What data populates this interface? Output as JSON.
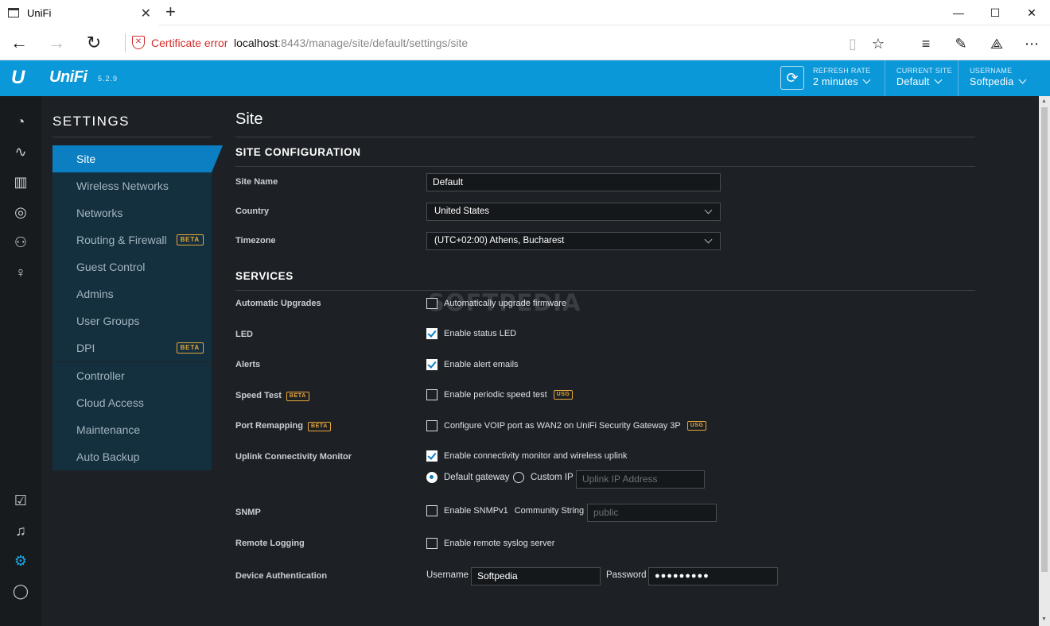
{
  "browser": {
    "tab_title": "UniFi",
    "new_tab_label": "+",
    "cert_error": "Certificate error",
    "url_host": "localhost",
    "url_path": ":8443/manage/site/default/settings/site"
  },
  "header": {
    "app_name": "UniFi",
    "version": "5.2.9",
    "refresh_rate_label": "REFRESH RATE",
    "refresh_rate_value": "2 minutes",
    "current_site_label": "CURRENT SITE",
    "current_site_value": "Default",
    "username_label": "USERNAME",
    "username_value": "Softpedia",
    "accent_color": "#0b98d9"
  },
  "settings_nav": {
    "title": "SETTINGS",
    "group1": [
      {
        "label": "Site",
        "active": true
      },
      {
        "label": "Wireless Networks"
      },
      {
        "label": "Networks"
      },
      {
        "label": "Routing & Firewall",
        "badge": "BETA"
      },
      {
        "label": "Guest Control"
      },
      {
        "label": "Admins"
      },
      {
        "label": "User Groups"
      },
      {
        "label": "DPI",
        "badge": "BETA"
      }
    ],
    "group2": [
      {
        "label": "Controller"
      },
      {
        "label": "Cloud Access"
      },
      {
        "label": "Maintenance"
      },
      {
        "label": "Auto Backup"
      }
    ]
  },
  "content": {
    "page_title": "Site",
    "site_config_title": "SITE CONFIGURATION",
    "site_name_label": "Site Name",
    "site_name_value": "Default",
    "country_label": "Country",
    "country_value": "United States",
    "timezone_label": "Timezone",
    "timezone_value": "(UTC+02:00) Athens, Bucharest",
    "services_title": "SERVICES",
    "auto_upgrades_label": "Automatic Upgrades",
    "auto_upgrades_text": "Automatically upgrade firmware",
    "led_label": "LED",
    "led_text": "Enable status LED",
    "alerts_label": "Alerts",
    "alerts_text": "Enable alert emails",
    "speed_test_label": "Speed Test",
    "speed_test_text": "Enable periodic speed test",
    "port_remap_label": "Port Remapping",
    "port_remap_text": "Configure VOIP port as WAN2 on UniFi Security Gateway 3P",
    "uplink_label": "Uplink Connectivity Monitor",
    "uplink_text": "Enable connectivity monitor and wireless uplink",
    "default_gateway": "Default gateway",
    "custom_ip": "Custom IP",
    "uplink_ip_placeholder": "Uplink IP Address",
    "snmp_label": "SNMP",
    "snmp_text": "Enable SNMPv1",
    "community_string_label": "Community String",
    "community_string_placeholder": "public",
    "remote_logging_label": "Remote Logging",
    "remote_logging_text": "Enable remote syslog server",
    "device_auth_label": "Device Authentication",
    "username_label": "Username",
    "username_value": "Softpedia",
    "password_label": "Password",
    "password_value": "●●●●●●●●●",
    "beta_badge": "BETA",
    "usg_badge": "USG",
    "watermark": "SOFTPEDIA"
  }
}
